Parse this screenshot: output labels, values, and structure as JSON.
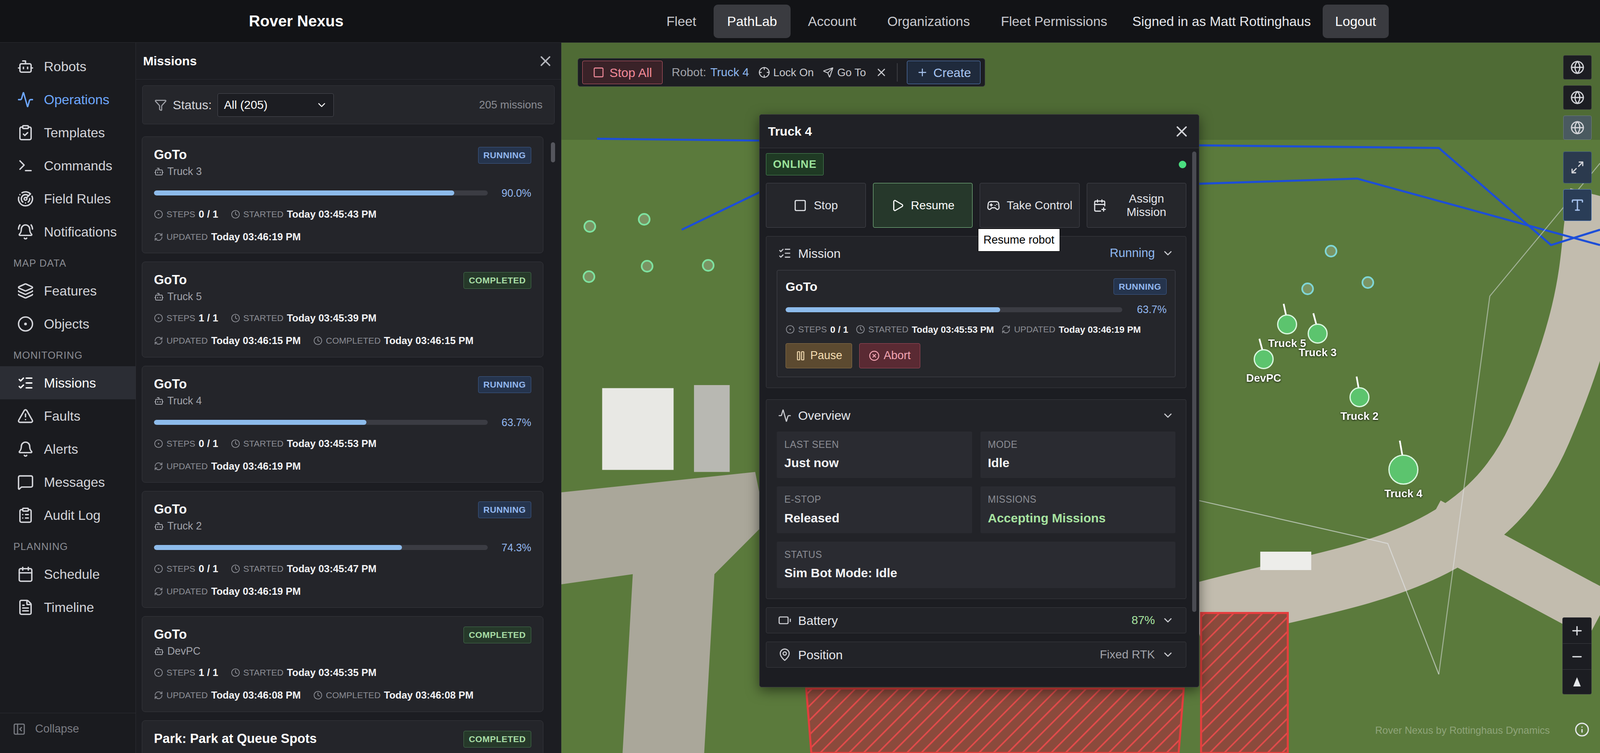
{
  "top_bar": {
    "brand": "Rover Nexus",
    "nav": [
      {
        "label": "Fleet",
        "selected": false
      },
      {
        "label": "PathLab",
        "selected": true
      },
      {
        "label": "Account",
        "selected": false
      },
      {
        "label": "Organizations",
        "selected": false
      },
      {
        "label": "Fleet Permissions",
        "selected": false
      }
    ],
    "signed_in": "Signed in as Matt Rottinghaus",
    "logout": "Logout"
  },
  "sidebar": {
    "groups": [
      {
        "items": [
          {
            "label": "Robots",
            "selected": false,
            "hovered": false
          },
          {
            "label": "Operations",
            "selected": false,
            "hovered": true
          },
          {
            "label": "Templates",
            "selected": false,
            "hovered": false
          },
          {
            "label": "Commands",
            "selected": false,
            "hovered": false
          },
          {
            "label": "Field Rules",
            "selected": false,
            "hovered": false
          },
          {
            "label": "Notifications",
            "selected": false,
            "hovered": false
          }
        ]
      },
      {
        "title": "MAP DATA",
        "items": [
          {
            "label": "Features",
            "selected": false,
            "hovered": false
          },
          {
            "label": "Objects",
            "selected": false,
            "hovered": false
          }
        ]
      },
      {
        "title": "MONITORING",
        "items": [
          {
            "label": "Missions",
            "selected": true,
            "hovered": false
          },
          {
            "label": "Faults",
            "selected": false,
            "hovered": false
          },
          {
            "label": "Alerts",
            "selected": false,
            "hovered": false
          },
          {
            "label": "Messages",
            "selected": false,
            "hovered": false
          },
          {
            "label": "Audit Log",
            "selected": false,
            "hovered": false
          }
        ]
      },
      {
        "title": "PLANNING",
        "items": [
          {
            "label": "Schedule",
            "selected": false,
            "hovered": false
          },
          {
            "label": "Timeline",
            "selected": false,
            "hovered": false
          }
        ]
      }
    ],
    "collapse": "Collapse"
  },
  "missions_panel": {
    "title": "Missions",
    "filter_label": "Status:",
    "filter_value": "All (205)",
    "count": "205 missions",
    "labels": {
      "steps": "STEPS",
      "started": "STARTED",
      "updated": "UPDATED",
      "completed": "COMPLETED"
    },
    "cards": [
      {
        "title": "GoTo",
        "robot": "Truck 3",
        "status": "RUNNING",
        "level": 0.9,
        "percent": "90.0%",
        "steps": "0 / 1",
        "started": "Today 03:45:43 PM",
        "updated": "Today 03:46:19 PM"
      },
      {
        "title": "GoTo",
        "robot": "Truck 5",
        "status": "COMPLETED",
        "steps": "1 / 1",
        "started": "Today 03:45:39 PM",
        "updated": "Today 03:46:15 PM",
        "completed": "Today 03:46:15 PM"
      },
      {
        "title": "GoTo",
        "robot": "Truck 4",
        "status": "RUNNING",
        "level": 0.637,
        "percent": "63.7%",
        "steps": "0 / 1",
        "started": "Today 03:45:53 PM",
        "updated": "Today 03:46:19 PM"
      },
      {
        "title": "GoTo",
        "robot": "Truck 2",
        "status": "RUNNING",
        "level": 0.743,
        "percent": "74.3%",
        "steps": "0 / 1",
        "started": "Today 03:45:47 PM",
        "updated": "Today 03:46:19 PM"
      },
      {
        "title": "GoTo",
        "robot": "DevPC",
        "status": "COMPLETED",
        "steps": "1 / 1",
        "started": "Today 03:45:35 PM",
        "updated": "Today 03:46:08 PM",
        "completed": "Today 03:46:08 PM"
      },
      {
        "title": "Park: Park at Queue Spots",
        "status": "COMPLETED"
      }
    ]
  },
  "map": {
    "toolbar": {
      "stop_all": "Stop All",
      "robot_label": "Robot:",
      "robot": "Truck 4",
      "lock_on": "Lock On",
      "go_to": "Go To",
      "create": "Create"
    },
    "layer_buttons": [
      {
        "selected": false
      },
      {
        "selected": false
      },
      {
        "selected": true
      }
    ],
    "pins": [
      {
        "label": "Truck 5",
        "selected": false
      },
      {
        "label": "Truck 3",
        "selected": false
      },
      {
        "label": "DevPC",
        "selected": false
      },
      {
        "label": "Truck 2",
        "selected": false
      },
      {
        "label": "Truck 4",
        "selected": true
      }
    ],
    "waypoints": [
      {
        "color": "#7ee2a0"
      },
      {
        "color": "#7ee2a0"
      },
      {
        "color": "#7ee2a0"
      },
      {
        "color": "#7ee2a0"
      },
      {
        "color": "#7ee2a0"
      },
      {
        "color": "#7fd6d6"
      },
      {
        "color": "#7fd6d6"
      },
      {
        "color": "#7fd6d6"
      }
    ],
    "watermark": "Rover Nexus by Rottinghaus Dynamics"
  },
  "robot_dialog": {
    "title": "Truck 4",
    "status": "ONLINE",
    "online": true,
    "actions": [
      {
        "label": "Stop",
        "selected": false
      },
      {
        "label": "Resume",
        "selected": true
      },
      {
        "label": "Take Control",
        "selected": false
      },
      {
        "label": "Assign Mission",
        "selected": false
      }
    ],
    "tooltip": "Resume robot",
    "mission": {
      "title": "Mission",
      "state": "Running",
      "expanded": true,
      "card": {
        "title": "GoTo",
        "status": "RUNNING",
        "level": 0.637,
        "percent": "63.7%",
        "steps": "0 / 1",
        "started": "Today 03:45:53 PM",
        "updated": "Today 03:46:19 PM"
      },
      "pause": "Pause",
      "abort": "Abort"
    },
    "overview": {
      "title": "Overview",
      "expanded": true,
      "fields": [
        {
          "label": "LAST SEEN",
          "value": "Just now",
          "color": "#f3f4f6"
        },
        {
          "label": "MODE",
          "value": "Idle",
          "color": "#f3f4f6"
        },
        {
          "label": "E-STOP",
          "value": "Released",
          "color": "#f3f4f6"
        },
        {
          "label": "MISSIONS",
          "value": "Accepting Missions",
          "color": "#a7e3a0"
        },
        {
          "label": "STATUS",
          "value": "Sim Bot Mode: Idle",
          "color": "#f3f4f6"
        }
      ]
    },
    "battery": {
      "title": "Battery",
      "value": "87%",
      "expanded": false
    },
    "position": {
      "title": "Position",
      "value": "Fixed RTK",
      "expanded": false
    }
  }
}
